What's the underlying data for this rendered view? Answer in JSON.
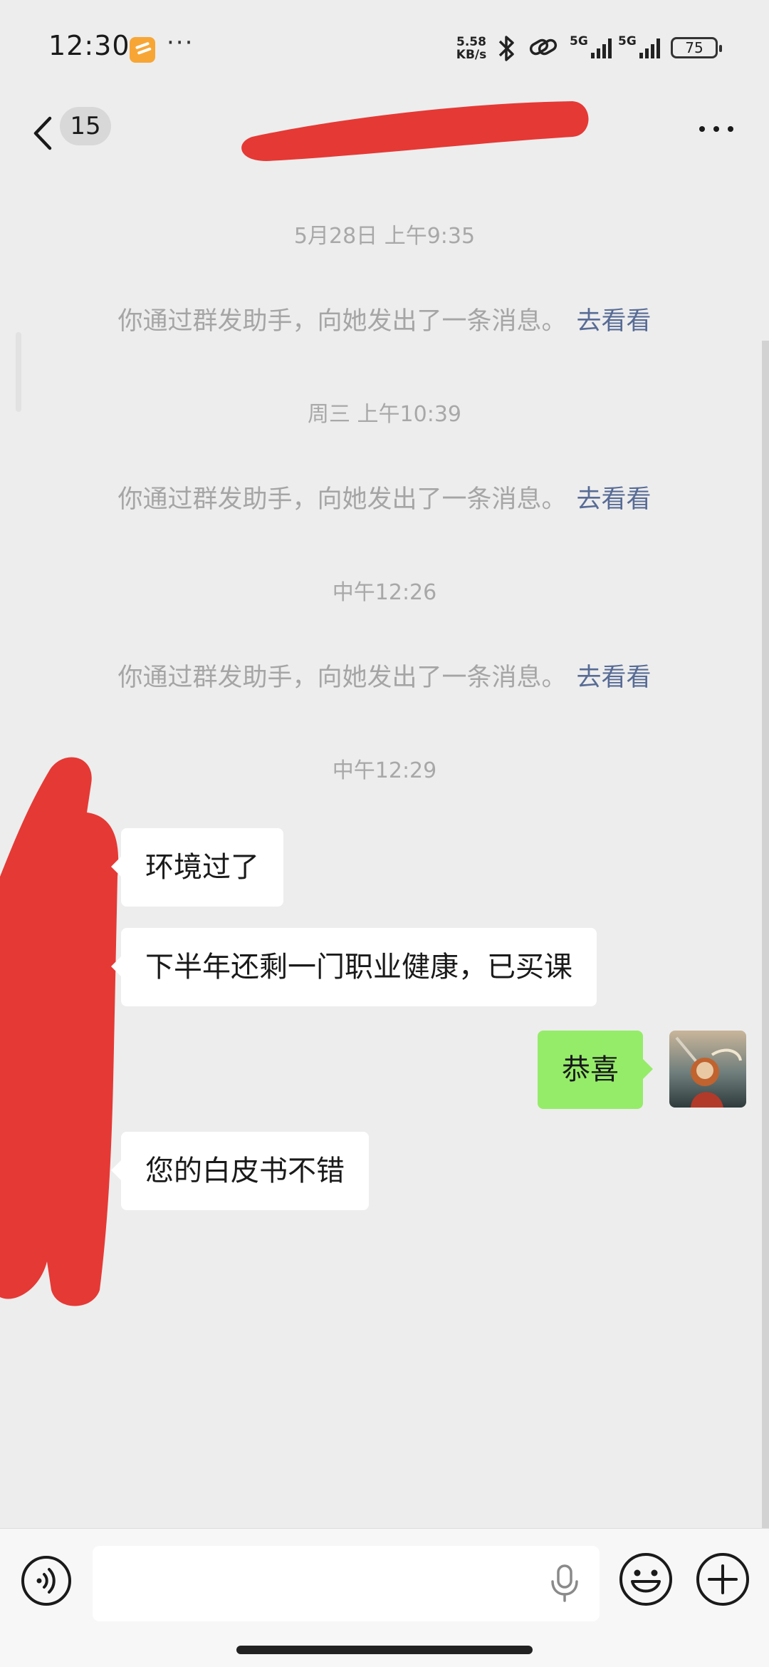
{
  "status_bar": {
    "time": "12:30",
    "more": "···",
    "net_speed_value": "5.58",
    "net_speed_unit": "KB/s",
    "signal_label_1": "5G",
    "signal_label_2": "5G",
    "battery": "75"
  },
  "nav": {
    "unread_count": "15"
  },
  "messages": {
    "ts1": "5月28日 上午9:35",
    "sys1": "你通过群发助手，向她发出了一条消息。",
    "ts2": "周三 上午10:39",
    "sys2": "你通过群发助手，向她发出了一条消息。",
    "ts3": "中午12:26",
    "sys3": "你通过群发助手，向她发出了一条消息。",
    "ts4": "中午12:29",
    "link": "去看看",
    "m1": "环境过了",
    "m2": "下半年还剩一门职业健康，已买课",
    "m3": "恭喜",
    "m4": "您的白皮书不错"
  },
  "colors": {
    "background": "#ededed",
    "bubble_self": "#95ec69",
    "bubble_other": "#ffffff",
    "link": "#576b95",
    "redaction": "#e53935"
  }
}
